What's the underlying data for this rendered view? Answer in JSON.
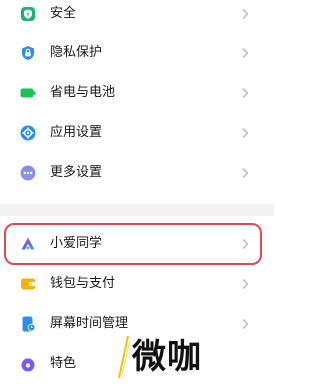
{
  "settings": {
    "items": [
      {
        "label": "安全",
        "icon": "shield-icon",
        "color": "#1fb46a"
      },
      {
        "label": "隐私保护",
        "icon": "privacy-lock-icon",
        "color": "#2a8ef0"
      },
      {
        "label": "省电与电池",
        "icon": "battery-icon",
        "color": "#1ec15a"
      },
      {
        "label": "应用设置",
        "icon": "app-settings-gear-icon",
        "color": "#2a8ef0"
      },
      {
        "label": "更多设置",
        "icon": "more-dots-icon",
        "color": "#8a8fe8"
      },
      {
        "label": "小爱同学",
        "icon": "xiaoai-assistant-icon",
        "color": "#6e5cf0"
      },
      {
        "label": "钱包与支付",
        "icon": "wallet-icon",
        "color": "#f5b400"
      },
      {
        "label": "屏幕时间管理",
        "icon": "screen-time-icon",
        "color": "#2a8ef0"
      },
      {
        "label": "特色",
        "icon": "features-icon",
        "color": "#7a5cf0"
      }
    ]
  },
  "highlight_color": "#e8474f",
  "watermark": {
    "text": "微咖"
  }
}
